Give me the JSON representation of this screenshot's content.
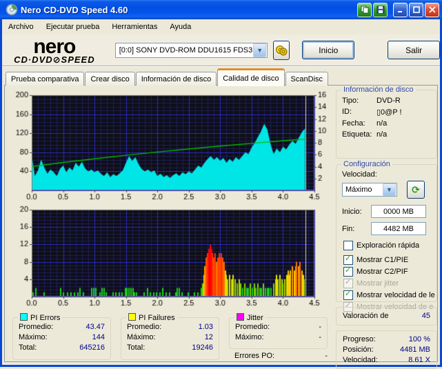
{
  "window": {
    "title": "Nero CD-DVD Speed 4.60"
  },
  "titlebar_buttons": {
    "copy": "copy-report",
    "save": "save-report",
    "minimize": "minimize",
    "maximize": "maximize",
    "close": "close"
  },
  "menu": {
    "items": [
      "Archivo",
      "Ejecutar prueba",
      "Herramientas",
      "Ayuda"
    ]
  },
  "header": {
    "logo_line1": "nero",
    "logo_line2": "CD·DVD⊘SPEED",
    "drive_value": "[0:0]   SONY DVD-ROM DDU1615 FDS3",
    "start_button": "Inicio",
    "exit_button": "Salir"
  },
  "tabs": [
    {
      "label": "Prueba comparativa",
      "active": false
    },
    {
      "label": "Crear disco",
      "active": false
    },
    {
      "label": "Información de disco",
      "active": false
    },
    {
      "label": "Calidad de disco",
      "active": true
    },
    {
      "label": "ScanDisc",
      "active": false
    }
  ],
  "sidebar": {
    "disc_info": {
      "title": "Información de disco",
      "rows": [
        {
          "label": "Tipo:",
          "value": "DVD-R"
        },
        {
          "label": "ID:",
          "value": "▯0@P !"
        },
        {
          "label": "Fecha:",
          "value": "n/a"
        },
        {
          "label": "Etiqueta:",
          "value": "n/a"
        }
      ]
    },
    "config": {
      "title": "Configuración",
      "speed_label": "Velocidad:",
      "speed_value": "Máximo",
      "start_label": "Inicio:",
      "start_value": "0000 MB",
      "end_label": "Fin:",
      "end_value": "4482 MB",
      "checkboxes": [
        {
          "label": "Exploración rápida",
          "checked": false,
          "disabled": false
        },
        {
          "label": "Mostrar C1/PIE",
          "checked": true,
          "disabled": false
        },
        {
          "label": "Mostrar C2/PIF",
          "checked": true,
          "disabled": false
        },
        {
          "label": "Mostrar jitter",
          "checked": true,
          "disabled": true
        },
        {
          "label": "Mostrar velocidad de le",
          "checked": true,
          "disabled": false
        },
        {
          "label": "Mostrar velocidad de e",
          "checked": true,
          "disabled": true
        }
      ]
    },
    "rating": {
      "label": "Valoración de",
      "value": "45"
    },
    "progress": {
      "rows": [
        {
          "label": "Progreso:",
          "value": "100 %"
        },
        {
          "label": "Posición:",
          "value": "4481 MB"
        },
        {
          "label": "Velocidad:",
          "value": "8.61 X"
        }
      ]
    }
  },
  "stats": {
    "pi_errors": {
      "title": "PI Errors",
      "swatch_color": "#00FFFF",
      "rows": [
        {
          "label": "Promedio:",
          "value": "43.47"
        },
        {
          "label": "Máximo:",
          "value": "144"
        },
        {
          "label": "Total:",
          "value": "645216"
        }
      ]
    },
    "pi_failures": {
      "title": "PI Failures",
      "swatch_color": "#FFFF00",
      "rows": [
        {
          "label": "Promedio:",
          "value": "1.03"
        },
        {
          "label": "Máximo:",
          "value": "12"
        },
        {
          "label": "Total:",
          "value": "19246"
        }
      ]
    },
    "jitter": {
      "title": "Jitter",
      "swatch_color": "#FF00FF",
      "rows": [
        {
          "label": "Promedio:",
          "value": "-"
        },
        {
          "label": "Máximo:",
          "value": "-"
        }
      ],
      "extra": {
        "label": "Errores PO:",
        "value": "-"
      }
    }
  },
  "colors": {
    "titlebar_blue": "#0050E3",
    "window_border": "#0847D8",
    "beige": "#ECE9D8",
    "groupbox_caption": "#3148A8",
    "value_navy": "#00008B",
    "tab_active_top": "#E68B2C",
    "chart_bg": "#0E0E16",
    "grid_major": "#2A2ACB",
    "grid_minor": "#1F1F5A",
    "pi_errors_area": "#00E6E6",
    "speed_line": "#00BE00",
    "position_marker": "#DDDDDD"
  },
  "chart_data": [
    {
      "type": "area",
      "title": "PI Errors y velocidad de lectura",
      "x_range": [
        0,
        4.5
      ],
      "x_major": 0.5,
      "x_minor": 0.1,
      "y_left": {
        "range": [
          0,
          200
        ],
        "major": 40,
        "minor": 8,
        "ticks": [
          200,
          160,
          120,
          80,
          40
        ]
      },
      "y_right": {
        "range": [
          0,
          16
        ],
        "ticks": [
          16,
          14,
          12,
          10,
          8,
          6,
          4,
          2
        ]
      },
      "x_ticks": [
        0,
        0.5,
        1,
        1.5,
        2,
        2.5,
        3,
        3.5,
        4,
        4.5
      ],
      "marker_x": 4.36,
      "area_series": {
        "name": "PI Errors",
        "color": "#00E6E6",
        "x_start": 0,
        "x_step": 0.05,
        "values": [
          75,
          30,
          42,
          65,
          48,
          35,
          44,
          38,
          30,
          45,
          52,
          38,
          48,
          42,
          58,
          50,
          60,
          46,
          40,
          44,
          38,
          42,
          35,
          30,
          38,
          28,
          34,
          30,
          36,
          42,
          58,
          72,
          62,
          70,
          55,
          45,
          40,
          44,
          38,
          42,
          30,
          35,
          28,
          32,
          26,
          32,
          36,
          30,
          38,
          34,
          40,
          36,
          44,
          52,
          48,
          58,
          66,
          72,
          64,
          70,
          62,
          68,
          58,
          66,
          60,
          70,
          64,
          72,
          80,
          76,
          90,
          100,
          112,
          124,
          140,
          128,
          98,
          76,
          88,
          80,
          92,
          86,
          96,
          104,
          98,
          110,
          122,
          130
        ]
      },
      "line_series": {
        "name": "Velocidad de lectura",
        "color": "#00BE00",
        "axis": "right",
        "x": [
          0,
          0.5,
          1,
          1.5,
          2,
          2.5,
          3,
          3.5,
          4,
          4.36
        ],
        "y": [
          4.0,
          4.7,
          5.3,
          5.9,
          6.45,
          6.95,
          7.45,
          7.9,
          8.35,
          8.61
        ]
      }
    },
    {
      "type": "bar",
      "title": "PI Failures",
      "x_range": [
        0,
        4.5
      ],
      "x_major": 0.5,
      "x_minor": 0.1,
      "y_left": {
        "range": [
          0,
          20
        ],
        "major": 4,
        "minor": 0.8,
        "ticks": [
          20,
          16,
          12,
          8,
          4
        ]
      },
      "x_ticks": [
        0,
        0.5,
        1,
        1.5,
        2,
        2.5,
        3,
        3.5,
        4,
        4.5
      ],
      "marker_x": 4.36,
      "bars": [
        [
          0.02,
          1
        ],
        [
          0.07,
          2
        ],
        [
          0.2,
          1
        ],
        [
          0.46,
          2
        ],
        [
          0.5,
          1
        ],
        [
          0.57,
          1
        ],
        [
          0.63,
          1
        ],
        [
          0.68,
          1
        ],
        [
          0.73,
          1
        ],
        [
          0.77,
          2
        ],
        [
          0.82,
          1
        ],
        [
          0.96,
          2
        ],
        [
          0.99,
          2
        ],
        [
          1.02,
          2
        ],
        [
          1.09,
          1
        ],
        [
          1.12,
          2
        ],
        [
          1.15,
          2
        ],
        [
          1.18,
          1
        ],
        [
          1.29,
          1
        ],
        [
          1.34,
          1
        ],
        [
          1.39,
          1
        ],
        [
          1.44,
          1
        ],
        [
          1.49,
          2
        ],
        [
          1.52,
          2
        ],
        [
          1.55,
          2
        ],
        [
          1.58,
          2
        ],
        [
          1.61,
          2
        ],
        [
          1.64,
          1
        ],
        [
          1.67,
          1
        ],
        [
          1.79,
          1
        ],
        [
          1.84,
          2
        ],
        [
          1.89,
          1
        ],
        [
          1.94,
          1
        ],
        [
          1.99,
          1
        ],
        [
          2.04,
          1
        ],
        [
          2.09,
          2
        ],
        [
          2.14,
          1
        ],
        [
          2.19,
          1
        ],
        [
          2.29,
          1
        ],
        [
          2.32,
          2
        ],
        [
          2.35,
          2
        ],
        [
          2.39,
          1
        ],
        [
          2.49,
          1
        ],
        [
          2.59,
          1
        ],
        [
          2.64,
          1
        ],
        [
          2.7,
          2
        ],
        [
          2.72,
          3
        ],
        [
          2.74,
          5
        ],
        [
          2.76,
          7
        ],
        [
          2.78,
          9
        ],
        [
          2.8,
          10
        ],
        [
          2.82,
          11
        ],
        [
          2.84,
          12
        ],
        [
          2.86,
          11
        ],
        [
          2.88,
          10
        ],
        [
          2.9,
          9
        ],
        [
          2.92,
          10
        ],
        [
          2.94,
          8
        ],
        [
          2.96,
          9
        ],
        [
          2.98,
          10
        ],
        [
          3.0,
          9
        ],
        [
          3.02,
          10
        ],
        [
          3.04,
          9
        ],
        [
          3.06,
          8
        ],
        [
          3.08,
          6
        ],
        [
          3.1,
          5
        ],
        [
          3.12,
          4
        ],
        [
          3.15,
          5
        ],
        [
          3.18,
          4
        ],
        [
          3.21,
          5
        ],
        [
          3.24,
          4
        ],
        [
          3.27,
          3
        ],
        [
          3.3,
          4
        ],
        [
          3.33,
          3
        ],
        [
          3.36,
          2
        ],
        [
          3.39,
          3
        ],
        [
          3.42,
          2
        ],
        [
          3.45,
          2
        ],
        [
          3.48,
          3
        ],
        [
          3.51,
          2
        ],
        [
          3.54,
          3
        ],
        [
          3.57,
          2
        ],
        [
          3.6,
          3
        ],
        [
          3.63,
          2
        ],
        [
          3.66,
          2
        ],
        [
          3.69,
          3
        ],
        [
          3.72,
          2
        ],
        [
          3.75,
          2
        ],
        [
          3.78,
          2
        ],
        [
          3.81,
          2
        ],
        [
          3.85,
          3
        ],
        [
          3.88,
          4
        ],
        [
          3.9,
          5
        ],
        [
          3.92,
          4
        ],
        [
          3.95,
          5
        ],
        [
          3.98,
          4
        ],
        [
          4.0,
          3
        ],
        [
          4.03,
          4
        ],
        [
          4.06,
          5
        ],
        [
          4.08,
          6
        ],
        [
          4.1,
          5
        ],
        [
          4.12,
          6
        ],
        [
          4.15,
          7
        ],
        [
          4.18,
          6
        ],
        [
          4.2,
          7
        ],
        [
          4.22,
          8
        ],
        [
          4.25,
          7
        ],
        [
          4.27,
          8
        ],
        [
          4.3,
          6
        ],
        [
          4.32,
          5
        ],
        [
          4.34,
          4
        ]
      ],
      "colormap": [
        [
          2,
          "#1FCC1F"
        ],
        [
          3,
          "#7ED400"
        ],
        [
          4,
          "#B4D800"
        ],
        [
          5,
          "#E6E600"
        ],
        [
          6,
          "#FFC800"
        ],
        [
          7,
          "#FF9900"
        ],
        [
          8,
          "#FF7300"
        ],
        [
          9,
          "#FF5200"
        ],
        [
          10,
          "#FF3000"
        ],
        [
          99,
          "#FF0000"
        ]
      ]
    }
  ]
}
